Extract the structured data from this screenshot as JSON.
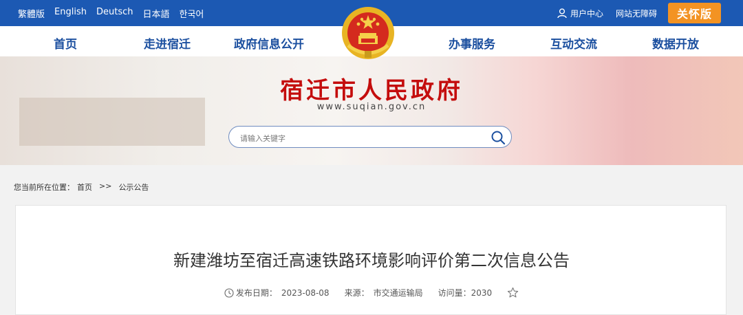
{
  "languages": [
    "繁體版",
    "English",
    "Deutsch",
    "日本語",
    "한국어"
  ],
  "topbar": {
    "user_center": "用户中心",
    "accessibility": "网站无障碍",
    "care_mode": "关怀版"
  },
  "nav": {
    "items": [
      "首页",
      "走进宿迁",
      "政府信息公开",
      "办事服务",
      "互动交流",
      "数据开放"
    ]
  },
  "header": {
    "title": "宿迁市人民政府",
    "domain": "www.suqian.gov.cn"
  },
  "search": {
    "placeholder": "请输入关键字"
  },
  "breadcrumb": {
    "label": "您当前所在位置：",
    "home": "首页",
    "separator": ">>",
    "current": "公示公告"
  },
  "article": {
    "title": "新建潍坊至宿迁高速铁路环境影响评价第二次信息公告",
    "date_label": "发布日期：",
    "date": "2023-08-08",
    "source_label": "来源：",
    "source": "市交通运输局",
    "views_label": "访问量：",
    "views": "2030"
  },
  "colors": {
    "topbar": "#1c59b3",
    "nav_text": "#1b4f9f",
    "title_red": "#c40d0d",
    "care_orange": "#f39323"
  },
  "icons": [
    "user-icon",
    "search-icon",
    "clock-icon",
    "star-icon",
    "national-emblem-icon"
  ]
}
